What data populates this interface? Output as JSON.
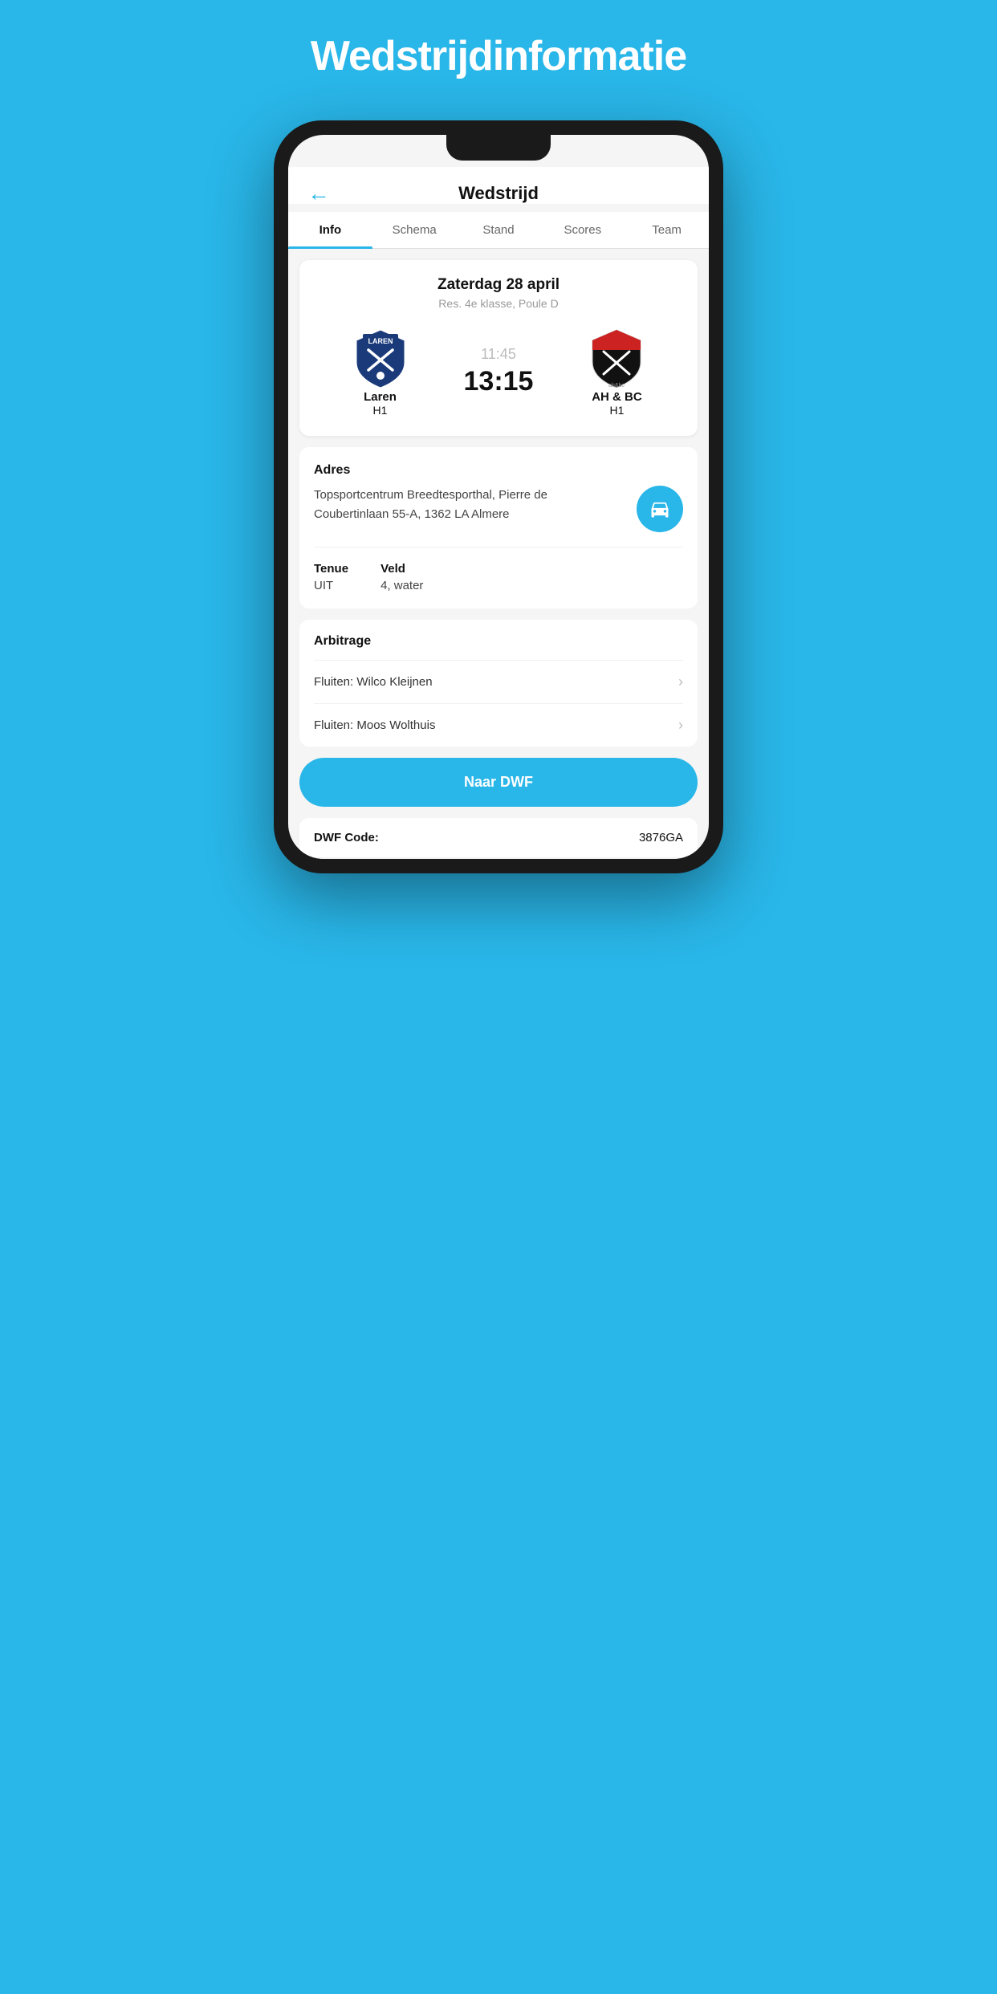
{
  "page": {
    "title": "Wedstrijdinformatie",
    "background_color": "#29b6e8"
  },
  "header": {
    "back_icon": "←",
    "title": "Wedstrijd"
  },
  "tabs": [
    {
      "label": "Info",
      "active": true
    },
    {
      "label": "Schema",
      "active": false
    },
    {
      "label": "Stand",
      "active": false
    },
    {
      "label": "Scores",
      "active": false
    },
    {
      "label": "Team",
      "active": false
    }
  ],
  "match": {
    "date": "Zaterdag 28 april",
    "league": "Res. 4e klasse, Poule D",
    "home_team": {
      "name": "Laren",
      "sub": "H1"
    },
    "away_team": {
      "name": "AH & BC",
      "sub": "H1"
    },
    "time": "11:45",
    "score": "13:15"
  },
  "info": {
    "address_label": "Adres",
    "address": "Topsportcentrum Breedtesporthal, Pierre de Coubertinlaan 55-A, 1362 LA Almere",
    "tenue_label": "Tenue",
    "tenue_value": "UIT",
    "veld_label": "Veld",
    "veld_value": "4, water"
  },
  "arbitrage": {
    "label": "Arbitrage",
    "items": [
      {
        "text": "Fluiten: Wilco Kleijnen"
      },
      {
        "text": "Fluiten: Moos Wolthuis"
      }
    ]
  },
  "dwf": {
    "button_label": "Naar DWF",
    "code_label": "DWF Code:",
    "code_value": "3876GA"
  }
}
